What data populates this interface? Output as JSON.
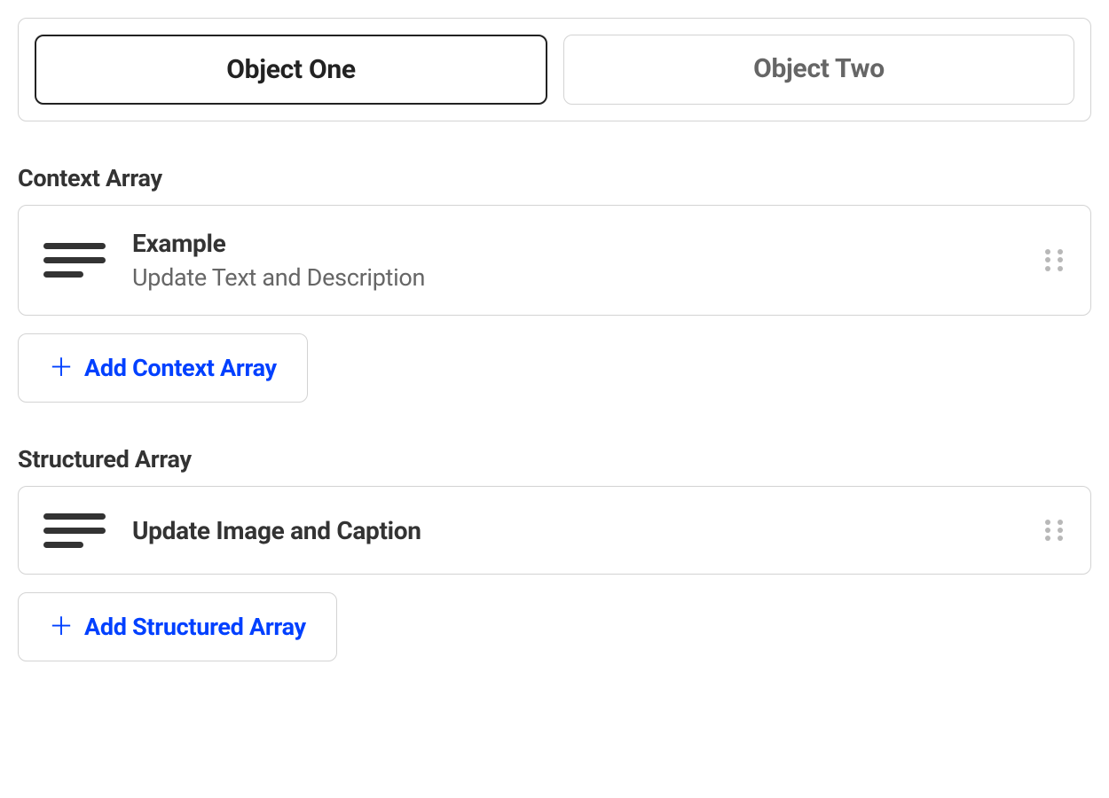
{
  "tabs": {
    "tab1": {
      "label": "Object One",
      "active": true
    },
    "tab2": {
      "label": "Object Two",
      "active": false
    }
  },
  "sections": {
    "context": {
      "label": "Context Array",
      "item": {
        "title": "Example",
        "subtitle": "Update Text and Description"
      },
      "add_label": "Add Context Array"
    },
    "structured": {
      "label": "Structured Array",
      "item": {
        "title": "Update Image and Caption"
      },
      "add_label": "Add Structured Array"
    }
  }
}
